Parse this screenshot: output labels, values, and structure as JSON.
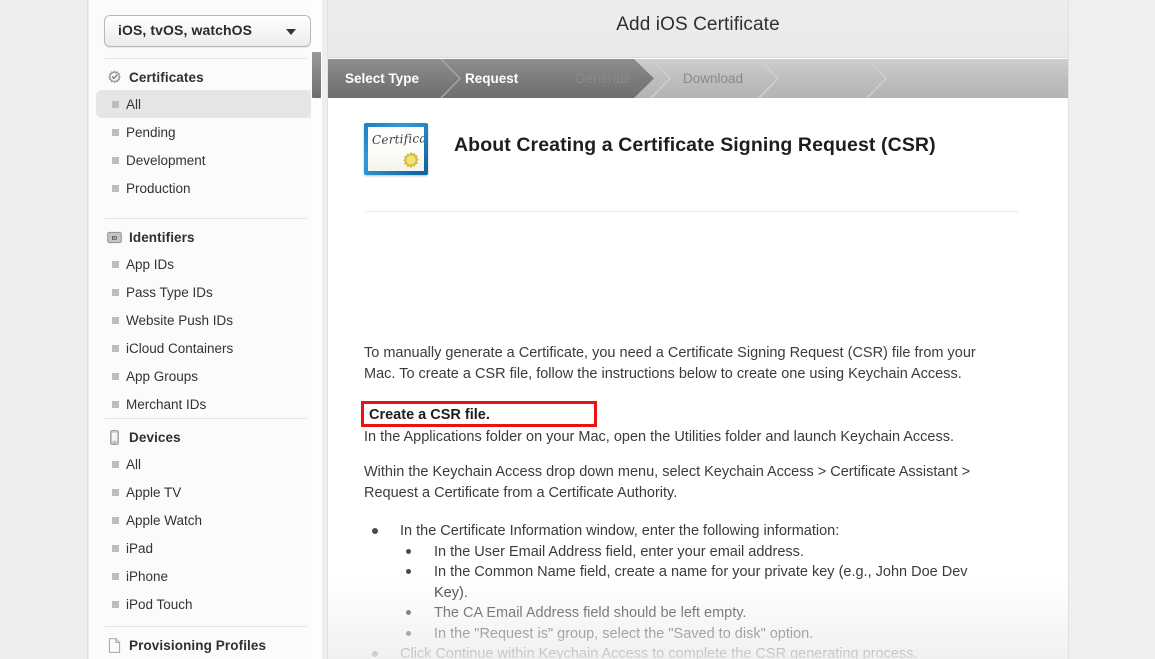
{
  "sidebar": {
    "platform_select": {
      "value": "iOS, tvOS, watchOS",
      "icon": "chevron-down-icon"
    },
    "groups": [
      {
        "title": "Certificates",
        "icon": "certificate-seal-icon",
        "items": [
          {
            "label": "All",
            "selected": true
          },
          {
            "label": "Pending",
            "selected": false
          },
          {
            "label": "Development",
            "selected": false
          },
          {
            "label": "Production",
            "selected": false
          }
        ]
      },
      {
        "title": "Identifiers",
        "icon": "id-badge-icon",
        "items": [
          {
            "label": "App IDs",
            "selected": false
          },
          {
            "label": "Pass Type IDs",
            "selected": false
          },
          {
            "label": "Website Push IDs",
            "selected": false
          },
          {
            "label": "iCloud Containers",
            "selected": false
          },
          {
            "label": "App Groups",
            "selected": false
          },
          {
            "label": "Merchant IDs",
            "selected": false
          }
        ]
      },
      {
        "title": "Devices",
        "icon": "device-phone-icon",
        "items": [
          {
            "label": "All",
            "selected": false
          },
          {
            "label": "Apple TV",
            "selected": false
          },
          {
            "label": "Apple Watch",
            "selected": false
          },
          {
            "label": "iPad",
            "selected": false
          },
          {
            "label": "iPhone",
            "selected": false
          },
          {
            "label": "iPod Touch",
            "selected": false
          }
        ]
      },
      {
        "title": "Provisioning Profiles",
        "icon": "document-page-icon",
        "items": []
      }
    ]
  },
  "panel": {
    "title": "Add iOS Certificate",
    "wizard": {
      "steps": [
        {
          "label": "Select Type",
          "state": "complete"
        },
        {
          "label": "Request",
          "state": "active"
        },
        {
          "label": "Generate",
          "state": "upcoming"
        },
        {
          "label": "Download",
          "state": "upcoming"
        }
      ]
    },
    "content": {
      "icon": "certificate-document-icon",
      "icon_caption": "Certificate",
      "heading": "About Creating a Certificate Signing Request (CSR)",
      "intro_paragraph": "To manually generate a Certificate, you need a Certificate Signing Request (CSR) file from your Mac. To create a CSR file, follow the instructions below to create one using Keychain Access.",
      "callout": {
        "text": "Create a CSR file.",
        "border_color": "#ee1111"
      },
      "applications_line": "In the Applications folder on your Mac, open the Utilities folder and launch Keychain Access.",
      "within_paragraph": "Within the Keychain Access drop down menu, select Keychain Access > Certificate Assistant > Request a Certificate from a Certificate Authority.",
      "bullets": {
        "first": "In the Certificate Information window, enter the following information:",
        "sub": [
          "In the User Email Address field, enter your email address.",
          "In the Common Name field, create a name for your private key (e.g., John Doe Dev Key).",
          "The CA Email Address field should be left empty.",
          "In the \"Request is\" group, select the \"Saved to disk\" option."
        ],
        "last": "Click Continue within Keychain Access to complete the CSR generating process."
      }
    }
  },
  "colors": {
    "page_background": "#efefef",
    "sidebar_background": "#fbfbfb",
    "panel_background": "#ffffff",
    "wizard_active": "#7b7b7b",
    "wizard_inactive": "#bdbdbd",
    "callout_red": "#ee1111",
    "cert_icon_blue": "#1b7fc4",
    "cert_seal_gold": "#e8d24a"
  }
}
